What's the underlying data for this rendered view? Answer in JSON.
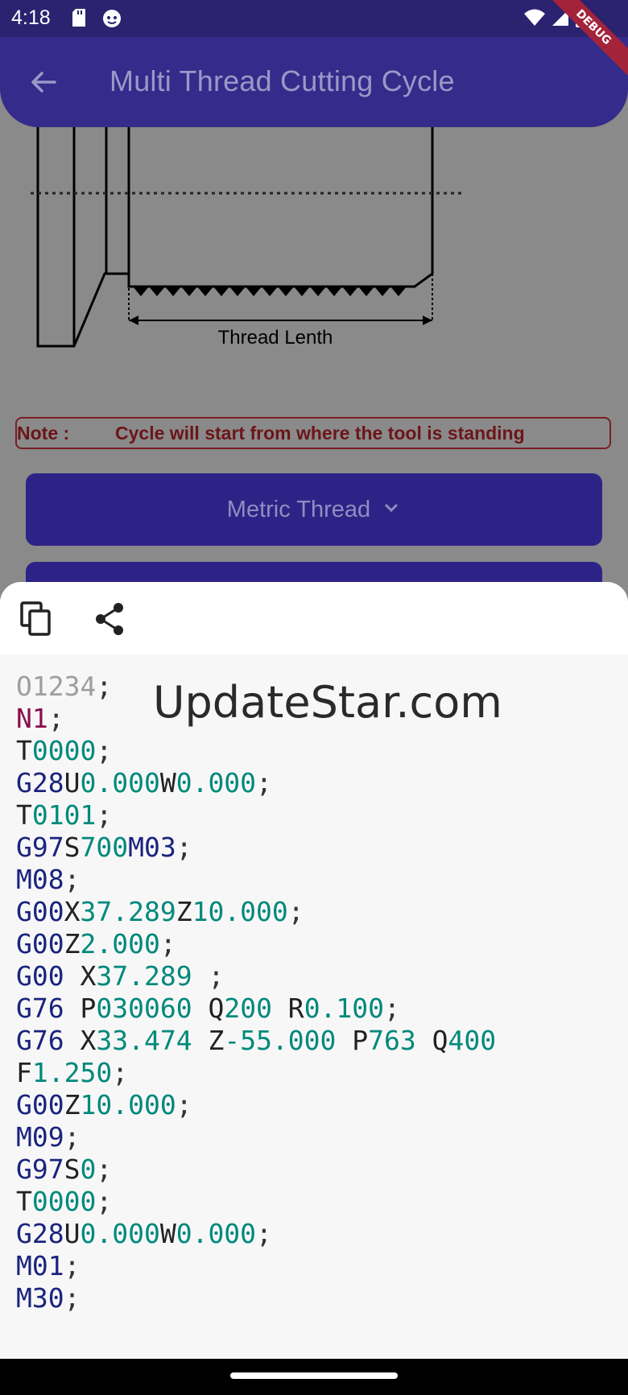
{
  "status_bar": {
    "time": "4:18",
    "debug_banner": "DEBUG"
  },
  "app_bar": {
    "title": "Multi Thread Cutting Cycle"
  },
  "diagram": {
    "label": "Thread Lenth"
  },
  "note": {
    "label": "Note :",
    "text": "Cycle will start from where the tool is standing"
  },
  "thread_type_button": {
    "label": "Metric Thread"
  },
  "watermark": "UpdateStar.com",
  "code_lines": [
    [
      {
        "t": "O1234",
        "c": "o"
      },
      {
        "t": ";",
        "c": "p"
      }
    ],
    [
      {
        "t": "N1",
        "c": "m"
      },
      {
        "t": ";",
        "c": "p"
      }
    ],
    [
      {
        "t": "T",
        "c": "t"
      },
      {
        "t": "0000",
        "c": "n"
      },
      {
        "t": ";",
        "c": "p"
      }
    ],
    [
      {
        "t": "G28",
        "c": "k"
      },
      {
        "t": "U",
        "c": "t"
      },
      {
        "t": "0.000",
        "c": "n"
      },
      {
        "t": "W",
        "c": "t"
      },
      {
        "t": "0.000",
        "c": "n"
      },
      {
        "t": ";",
        "c": "p"
      }
    ],
    [
      {
        "t": "T",
        "c": "t"
      },
      {
        "t": "0101",
        "c": "n"
      },
      {
        "t": ";",
        "c": "p"
      }
    ],
    [
      {
        "t": "G97",
        "c": "k"
      },
      {
        "t": "S",
        "c": "t"
      },
      {
        "t": "700",
        "c": "n"
      },
      {
        "t": "M03",
        "c": "k"
      },
      {
        "t": ";",
        "c": "p"
      }
    ],
    [
      {
        "t": "M08",
        "c": "k"
      },
      {
        "t": ";",
        "c": "p"
      }
    ],
    [
      {
        "t": "G00",
        "c": "k"
      },
      {
        "t": "X",
        "c": "t"
      },
      {
        "t": "37.289",
        "c": "n"
      },
      {
        "t": "Z",
        "c": "t"
      },
      {
        "t": "10.000",
        "c": "n"
      },
      {
        "t": ";",
        "c": "p"
      }
    ],
    [
      {
        "t": "G00",
        "c": "k"
      },
      {
        "t": "Z",
        "c": "t"
      },
      {
        "t": "2.000",
        "c": "n"
      },
      {
        "t": ";",
        "c": "p"
      }
    ],
    [
      {
        "t": "G00 ",
        "c": "k"
      },
      {
        "t": "X",
        "c": "t"
      },
      {
        "t": "37.289",
        "c": "n"
      },
      {
        "t": " ;",
        "c": "p"
      }
    ],
    [
      {
        "t": "G76 ",
        "c": "k"
      },
      {
        "t": "P",
        "c": "t"
      },
      {
        "t": "030060",
        "c": "n"
      },
      {
        "t": " Q",
        "c": "t"
      },
      {
        "t": "200",
        "c": "n"
      },
      {
        "t": " R",
        "c": "t"
      },
      {
        "t": "0.100",
        "c": "n"
      },
      {
        "t": ";",
        "c": "p"
      }
    ],
    [
      {
        "t": "G76 ",
        "c": "k"
      },
      {
        "t": "X",
        "c": "t"
      },
      {
        "t": "33.474",
        "c": "n"
      },
      {
        "t": " Z",
        "c": "t"
      },
      {
        "t": "-55.000",
        "c": "n"
      },
      {
        "t": " P",
        "c": "t"
      },
      {
        "t": "763",
        "c": "n"
      },
      {
        "t": " Q",
        "c": "t"
      },
      {
        "t": "400",
        "c": "n"
      }
    ],
    [
      {
        "t": "F",
        "c": "t"
      },
      {
        "t": "1.250",
        "c": "n"
      },
      {
        "t": ";",
        "c": "p"
      }
    ],
    [
      {
        "t": "G00",
        "c": "k"
      },
      {
        "t": "Z",
        "c": "t"
      },
      {
        "t": "10.000",
        "c": "n"
      },
      {
        "t": ";",
        "c": "p"
      }
    ],
    [
      {
        "t": "M09",
        "c": "k"
      },
      {
        "t": ";",
        "c": "p"
      }
    ],
    [
      {
        "t": "G97",
        "c": "k"
      },
      {
        "t": "S",
        "c": "t"
      },
      {
        "t": "0",
        "c": "n"
      },
      {
        "t": ";",
        "c": "p"
      }
    ],
    [
      {
        "t": "T",
        "c": "t"
      },
      {
        "t": "0000",
        "c": "n"
      },
      {
        "t": ";",
        "c": "p"
      }
    ],
    [
      {
        "t": "G28",
        "c": "k"
      },
      {
        "t": "U",
        "c": "t"
      },
      {
        "t": "0.000",
        "c": "n"
      },
      {
        "t": "W",
        "c": "t"
      },
      {
        "t": "0.000",
        "c": "n"
      },
      {
        "t": ";",
        "c": "p"
      }
    ],
    [
      {
        "t": "M01",
        "c": "k"
      },
      {
        "t": ";",
        "c": "p"
      }
    ],
    [
      {
        "t": "M30",
        "c": "k"
      },
      {
        "t": ";",
        "c": "p"
      }
    ]
  ],
  "colors": {
    "app_bar": "#352b8a",
    "button": "#2d2386",
    "note": "#6c1519",
    "code_keyword": "#1a237e",
    "code_number": "#00897b",
    "code_sequence": "#880e4f"
  },
  "icons": {
    "back": "arrow-left-icon",
    "copy": "copy-icon",
    "share": "share-icon",
    "dropdown": "chevron-down-icon"
  }
}
